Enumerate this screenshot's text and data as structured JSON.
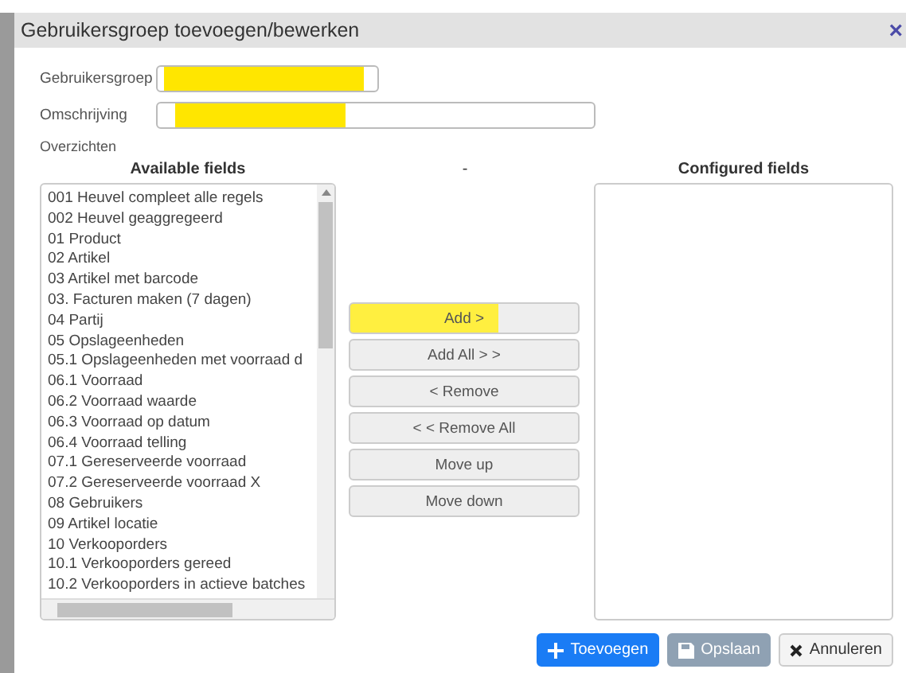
{
  "window": {
    "title": "Gebruikersgroep toevoegen/bewerken",
    "close": "×"
  },
  "fields": [
    {
      "label": "Gebruikersgroep",
      "highlighted": true,
      "wide": false
    },
    {
      "label": "Omschrijving",
      "highlighted": true,
      "wide": true
    }
  ],
  "section": "Overzichten",
  "columns": {
    "left": "Available fields",
    "middle": "-",
    "right": "Configured fields"
  },
  "available": [
    "001 Heuvel compleet alle regels",
    "002 Heuvel geaggregeerd",
    "01 Product",
    "02 Artikel",
    "03 Artikel met barcode",
    "03. Facturen maken (7 dagen)",
    "04 Partij",
    "05 Opslageenheden",
    "05.1 Opslageenheden met voorraad d",
    "06.1 Voorraad",
    "06.2 Voorraad waarde",
    "06.3 Voorraad op datum",
    "06.4 Voorraad telling",
    "07.1 Gereserveerde voorraad",
    "07.2 Gereserveerde voorraad X",
    "08 Gebruikers",
    "09 Artikel locatie",
    "10 Verkooporders",
    "10.1 Verkooporders gereed",
    "10.2 Verkooporders in actieve batches"
  ],
  "transfer_buttons": [
    {
      "label": "Add >",
      "highlighted": true
    },
    {
      "label": "Add All > >",
      "highlighted": false
    },
    {
      "label": "< Remove",
      "highlighted": false
    },
    {
      "label": "< < Remove All",
      "highlighted": false
    },
    {
      "label": "Move up",
      "highlighted": false
    },
    {
      "label": "Move down",
      "highlighted": false
    }
  ],
  "actions": [
    {
      "label": "Toevoegen",
      "kind": "primary",
      "disabled": false
    },
    {
      "label": "Opslaan",
      "kind": "save",
      "disabled": true
    },
    {
      "label": "Annuleren",
      "kind": "cancel",
      "disabled": false
    }
  ]
}
